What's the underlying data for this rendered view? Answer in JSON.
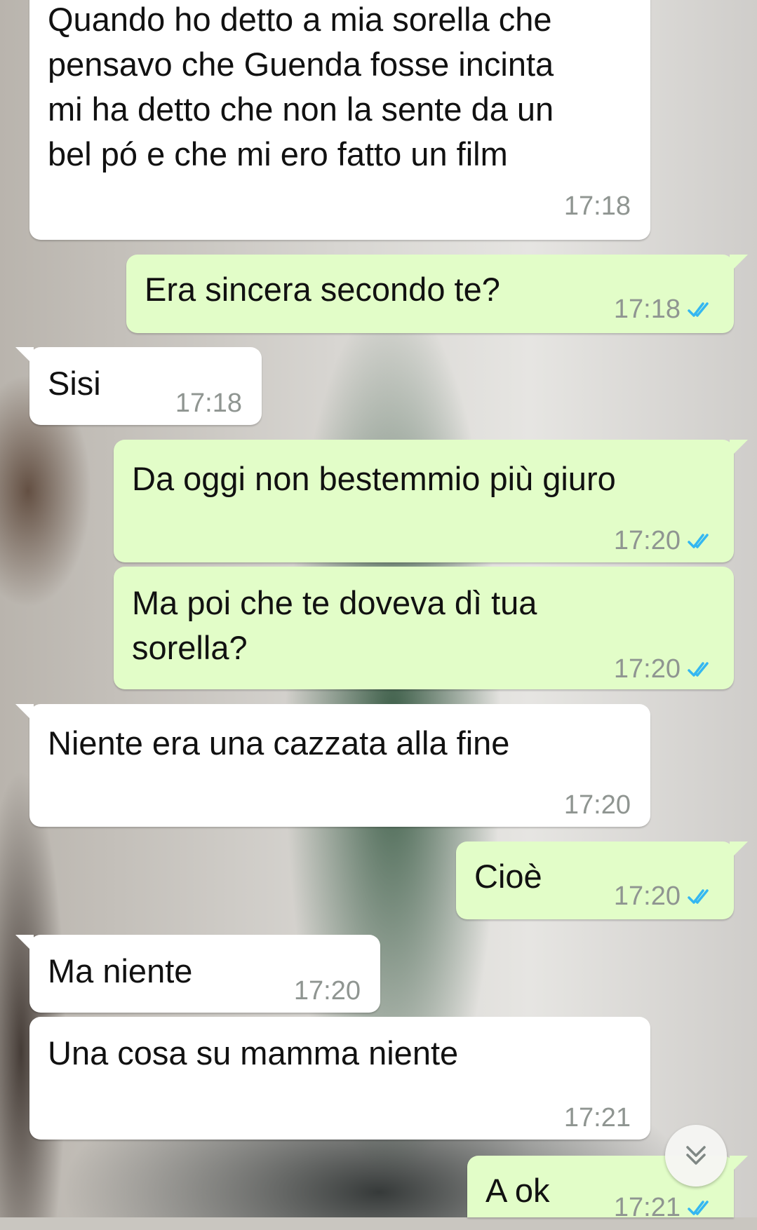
{
  "chat": {
    "messages": [
      {
        "direction": "incoming",
        "text_lines": [
          "Quando ho detto a mia sorella che",
          "pensavo che Guenda fosse incinta",
          "mi ha detto che non la sente da un",
          "bel pó e che mi ero fatto un film"
        ],
        "time": "17:18"
      },
      {
        "direction": "outgoing",
        "text_lines": [
          "Era sincera secondo te?"
        ],
        "time": "17:18",
        "status": "read"
      },
      {
        "direction": "incoming",
        "text_lines": [
          "Sisi"
        ],
        "time": "17:18"
      },
      {
        "direction": "outgoing",
        "text_lines": [
          "Da oggi non bestemmio più giuro"
        ],
        "time": "17:20",
        "status": "read"
      },
      {
        "direction": "outgoing",
        "text_lines": [
          "Ma poi che te doveva dì tua",
          "sorella?"
        ],
        "time": "17:20",
        "status": "read"
      },
      {
        "direction": "incoming",
        "text_lines": [
          "Niente era una cazzata alla fine"
        ],
        "time": "17:20"
      },
      {
        "direction": "outgoing",
        "text_lines": [
          "Cioè"
        ],
        "time": "17:20",
        "status": "read"
      },
      {
        "direction": "incoming",
        "text_lines": [
          "Ma niente"
        ],
        "time": "17:20"
      },
      {
        "direction": "incoming",
        "text_lines": [
          "Una cosa su mamma niente"
        ],
        "time": "17:21"
      },
      {
        "direction": "outgoing",
        "text_lines": [
          "A ok"
        ],
        "time": "17:21",
        "status": "read"
      }
    ]
  },
  "colors": {
    "incoming_bubble": "#ffffff",
    "outgoing_bubble": "#e2fdc8",
    "read_ticks": "#34b7f1",
    "timestamp": "#8f9591"
  },
  "icons": {
    "read_receipt": "double-check-icon",
    "scroll_down": "double-chevron-down-icon"
  }
}
